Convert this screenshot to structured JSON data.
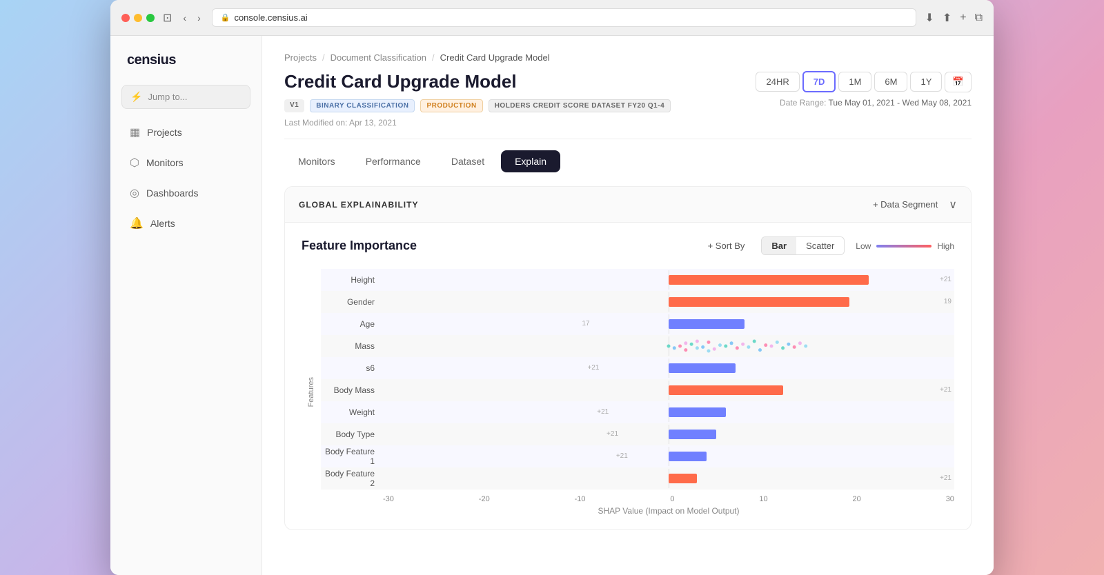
{
  "browser": {
    "url": "console.censius.ai",
    "reload_icon": "↻"
  },
  "breadcrumb": {
    "items": [
      "Projects",
      "Document Classification",
      "Credit Card Upgrade Model"
    ],
    "separators": [
      "/",
      "/"
    ]
  },
  "page": {
    "title": "Credit Card Upgrade Model",
    "tags": [
      {
        "label": "V1",
        "type": "v1"
      },
      {
        "label": "BINARY CLASSIFICATION",
        "type": "binary"
      },
      {
        "label": "PRODUCTION",
        "type": "production"
      },
      {
        "label": "HOLDERS CREDIT SCORE DATASET FY20 Q1-4",
        "type": "dataset"
      }
    ],
    "last_modified": "Last Modified on: Apr 13, 2021"
  },
  "time_controls": {
    "buttons": [
      "24HR",
      "7D",
      "1M",
      "6M",
      "1Y"
    ],
    "active": "7D",
    "date_range_label": "Date Range:",
    "date_range": "Tue May 01, 2021  -  Wed May 08, 2021"
  },
  "tabs": [
    {
      "label": "Monitors",
      "active": false
    },
    {
      "label": "Performance",
      "active": false
    },
    {
      "label": "Dataset",
      "active": false
    },
    {
      "label": "Explain",
      "active": true
    }
  ],
  "explainability": {
    "section_title": "GLOBAL EXPLAINABILITY",
    "add_segment_label": "+ Data Segment",
    "feature_importance_title": "Feature Importance",
    "sort_label": "+ Sort By",
    "chart_types": [
      {
        "label": "Bar",
        "active": true
      },
      {
        "label": "Scatter",
        "active": false
      }
    ],
    "color_scale_low": "Low",
    "color_scale_high": "High",
    "y_axis_label": "Features",
    "x_axis_labels": [
      "-30",
      "-20",
      "-10",
      "0",
      "10",
      "20",
      "30"
    ],
    "x_axis_title": "SHAP Value (Impact on Model Output)",
    "features": [
      {
        "name": "Height",
        "value": 21,
        "type": "orange",
        "width_pct": 85,
        "offset_pct": 50,
        "label_pos": "right",
        "label": "+21"
      },
      {
        "name": "Gender",
        "value": 19,
        "type": "orange",
        "width_pct": 80,
        "offset_pct": 50,
        "label_pos": "right",
        "label": "19"
      },
      {
        "name": "Age",
        "value": 17,
        "type": "blue",
        "width_pct": 45,
        "offset_pct": 50,
        "label_pos": "left",
        "label": "17"
      },
      {
        "name": "Mass",
        "value": null,
        "type": "scatter",
        "offset_pct": 50
      },
      {
        "name": "s6",
        "value": 21,
        "type": "blue",
        "width_pct": 40,
        "offset_pct": 50,
        "label_pos": "left",
        "label": "+21"
      },
      {
        "name": "Body Mass",
        "value": 21,
        "type": "orange",
        "width_pct": 45,
        "offset_pct": 50,
        "label_pos": "right",
        "label": "+21"
      },
      {
        "name": "Weight",
        "value": 21,
        "type": "blue",
        "width_pct": 27,
        "offset_pct": 50,
        "label_pos": "left",
        "label": "+21"
      },
      {
        "name": "Body Type",
        "value": 21,
        "type": "blue",
        "width_pct": 22,
        "offset_pct": 50,
        "label_pos": "left",
        "label": "+21"
      },
      {
        "name": "Body Feature 1",
        "value": 21,
        "type": "blue",
        "width_pct": 18,
        "offset_pct": 50,
        "label_pos": "left",
        "label": "+21"
      },
      {
        "name": "Body Feature 2",
        "value": 21,
        "type": "orange",
        "width_pct": 12,
        "offset_pct": 50,
        "label_pos": "left",
        "label": "+21"
      }
    ]
  },
  "sidebar": {
    "logo": "censius",
    "jump_to_placeholder": "Jump to...",
    "nav_items": [
      {
        "label": "Projects",
        "icon": "▦",
        "active": false
      },
      {
        "label": "Monitors",
        "icon": "⬡",
        "active": false
      },
      {
        "label": "Dashboards",
        "icon": "◎",
        "active": false
      },
      {
        "label": "Alerts",
        "icon": "🔔",
        "active": false
      }
    ]
  }
}
